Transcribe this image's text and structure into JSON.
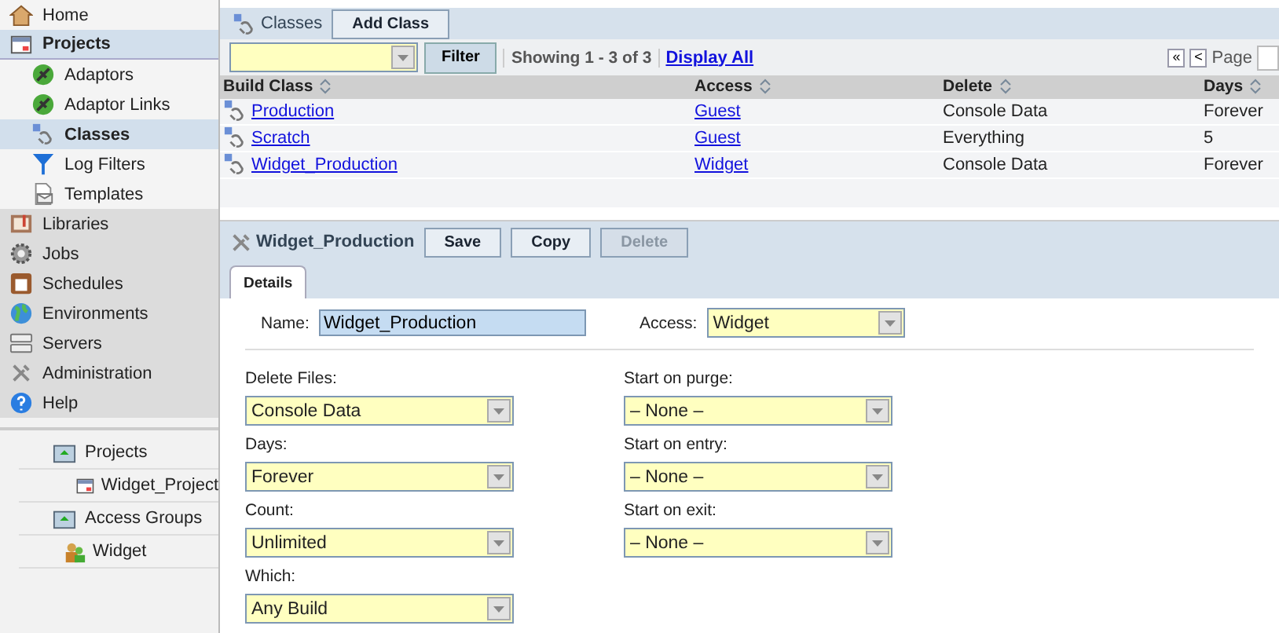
{
  "sidebar": {
    "items": [
      {
        "label": "Home",
        "selected": false
      },
      {
        "label": "Projects",
        "selected": true,
        "children": [
          {
            "label": "Adaptors",
            "selected": false
          },
          {
            "label": "Adaptor Links",
            "selected": false
          },
          {
            "label": "Classes",
            "selected": true
          },
          {
            "label": "Log Filters",
            "selected": false
          },
          {
            "label": "Templates",
            "selected": false
          }
        ]
      },
      {
        "label": "Libraries",
        "selected": false
      },
      {
        "label": "Jobs",
        "selected": false
      },
      {
        "label": "Schedules",
        "selected": false
      },
      {
        "label": "Environments",
        "selected": false
      },
      {
        "label": "Servers",
        "selected": false
      },
      {
        "label": "Administration",
        "selected": false
      },
      {
        "label": "Help",
        "selected": false
      }
    ],
    "tree": [
      {
        "label": "Projects",
        "children": [
          {
            "label": "Widget_Project"
          }
        ]
      },
      {
        "label": "Access Groups",
        "children": [
          {
            "label": "Widget"
          }
        ]
      }
    ]
  },
  "toolbar": {
    "title": "Classes",
    "button": "Add Class"
  },
  "filter": {
    "button": "Filter",
    "showing": "Showing 1 - 3 of 3",
    "link": "Display All",
    "pager": {
      "first": "«",
      "prev": "<",
      "label": "Page"
    }
  },
  "table": {
    "columns": [
      "Build Class",
      "Access",
      "Delete",
      "Days"
    ],
    "rows": [
      {
        "cells": [
          "Production",
          "Guest",
          "Console Data",
          "Forever"
        ]
      },
      {
        "cells": [
          "Scratch",
          "Guest",
          "Everything",
          "5"
        ]
      },
      {
        "cells": [
          "Widget_Production",
          "Widget",
          "Console Data",
          "Forever"
        ]
      }
    ]
  },
  "detail": {
    "title": "Widget_Production",
    "buttons": [
      {
        "label": "Save",
        "disabled": false
      },
      {
        "label": "Copy",
        "disabled": false
      },
      {
        "label": "Delete",
        "disabled": true
      }
    ],
    "tabs": [
      {
        "label": "Details",
        "selected": true
      }
    ],
    "name": {
      "label": "Name:",
      "value": "Widget_Production"
    },
    "access": {
      "label": "Access:",
      "value": "Widget"
    },
    "left_fields": [
      {
        "label": "Delete Files:",
        "value": "Console Data"
      },
      {
        "label": "Days:",
        "value": "Forever"
      },
      {
        "label": "Count:",
        "value": "Unlimited"
      },
      {
        "label": "Which:",
        "value": "Any Build"
      }
    ],
    "right_fields": [
      {
        "label": "Start on purge:",
        "value": "– None –"
      },
      {
        "label": "Start on entry:",
        "value": "– None –"
      },
      {
        "label": "Start on exit:",
        "value": "– None –"
      }
    ]
  }
}
